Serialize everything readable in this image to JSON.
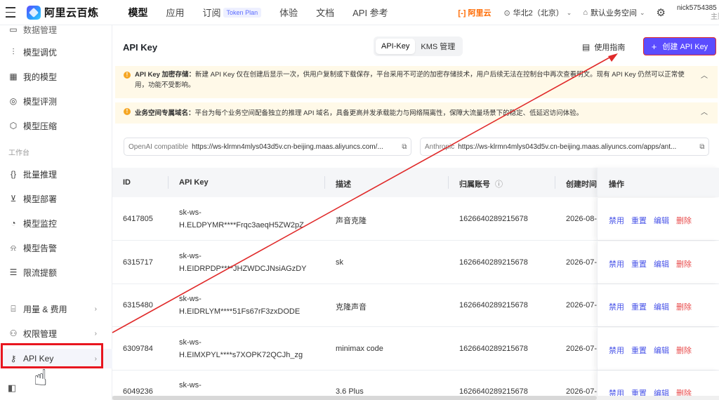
{
  "header": {
    "brand": "阿里云百炼",
    "nav": [
      {
        "label": "模型",
        "active": true
      },
      {
        "label": "应用"
      },
      {
        "label": "订阅",
        "badge": "Token Plan"
      },
      {
        "label": "体验"
      },
      {
        "label": "文档"
      },
      {
        "label": "API 参考"
      }
    ],
    "aliyun": "[-] 阿里云",
    "region": "华北2（北京）",
    "workspace": "默认业务空间",
    "user_name": "nick5754385",
    "user_sub": "主账"
  },
  "sidebar": {
    "items_top": [
      {
        "label": "数据管理",
        "icon": "database-icon"
      },
      {
        "label": "模型调优",
        "icon": "sliders-icon"
      },
      {
        "label": "我的模型",
        "icon": "grid-icon"
      },
      {
        "label": "模型评测",
        "icon": "compass-icon"
      },
      {
        "label": "模型压缩",
        "icon": "cube-icon"
      }
    ],
    "group_label": "工作台",
    "items_work": [
      {
        "label": "批量推理",
        "icon": "brackets-icon"
      },
      {
        "label": "模型部署",
        "icon": "download-box-icon"
      },
      {
        "label": "模型监控",
        "icon": "pie-icon"
      },
      {
        "label": "模型告警",
        "icon": "alarm-icon"
      },
      {
        "label": "限流提额",
        "icon": "stack-icon"
      }
    ],
    "items_bottom": [
      {
        "label": "用量 & 费用",
        "icon": "bag-icon"
      },
      {
        "label": "权限管理",
        "icon": "user-icon"
      },
      {
        "label": "API Key",
        "icon": "key-icon"
      }
    ]
  },
  "page": {
    "title": "API Key",
    "tabs": [
      "API-Key",
      "KMS 管理"
    ],
    "guide": "使用指南",
    "create": "创建 API Key"
  },
  "notices": [
    {
      "title": "API Key 加密存储：",
      "text": "新建 API Key 仅在创建后显示一次，供用户复制或下载保存，平台采用不可逆的加密存储技术，用户后续无法在控制台中再次查看明文。现有 API Key 仍然可以正常使用，功能不受影响。"
    },
    {
      "title": "业务空间专属域名：",
      "text": "平台为每个业务空间配备独立的推理 API 域名，具备更高并发承载能力与网络隔离性，保障大流量场景下的稳定、低延迟访问体验。"
    }
  ],
  "endpoints": [
    {
      "label": "OpenAI compatible",
      "url": "https://ws-klrmn4mlys043d5v.cn-beijing.maas.aliyuncs.com/..."
    },
    {
      "label": "Anthropic",
      "url": "https://ws-klrmn4mlys043d5v.cn-beijing.maas.aliyuncs.com/apps/ant..."
    }
  ],
  "table": {
    "columns": [
      "ID",
      "API Key",
      "描述",
      "归属账号",
      "创建时间",
      "操作"
    ],
    "ops": [
      "禁用",
      "重置",
      "编辑",
      "删除"
    ],
    "rows": [
      {
        "id": "6417805",
        "key1": "sk-ws-",
        "key2": "H.ELDPYMR****Frqc3aeqH5ZW2pZ",
        "desc": "声音克隆",
        "account": "1626640289215678",
        "created": "2026-08-"
      },
      {
        "id": "6315717",
        "key1": "sk-ws-",
        "key2": "H.EIDRPDP****JHZWDCJNsiAGzDY",
        "desc": "sk",
        "account": "1626640289215678",
        "created": "2026-07-"
      },
      {
        "id": "6315480",
        "key1": "sk-ws-",
        "key2": "H.EIDRLYM****51Fs67rF3zxDODE",
        "desc": "克隆声音",
        "account": "1626640289215678",
        "created": "2026-07-"
      },
      {
        "id": "6309784",
        "key1": "sk-ws-",
        "key2": "H.EIMXPYL****s7XOPK72QCJh_zg",
        "desc": "minimax code",
        "account": "1626640289215678",
        "created": "2026-07-"
      },
      {
        "id": "6049236",
        "key1": "sk-ws-",
        "key2": "",
        "desc": "3.6 Plus",
        "account": "1626640289215678",
        "created": "2026-07-"
      }
    ]
  },
  "colors": {
    "accent": "#5b4cff",
    "highlight": "#e8161f",
    "notice_bg": "#fff9e8",
    "link": "#4a55e8",
    "danger": "#e84a4a"
  }
}
